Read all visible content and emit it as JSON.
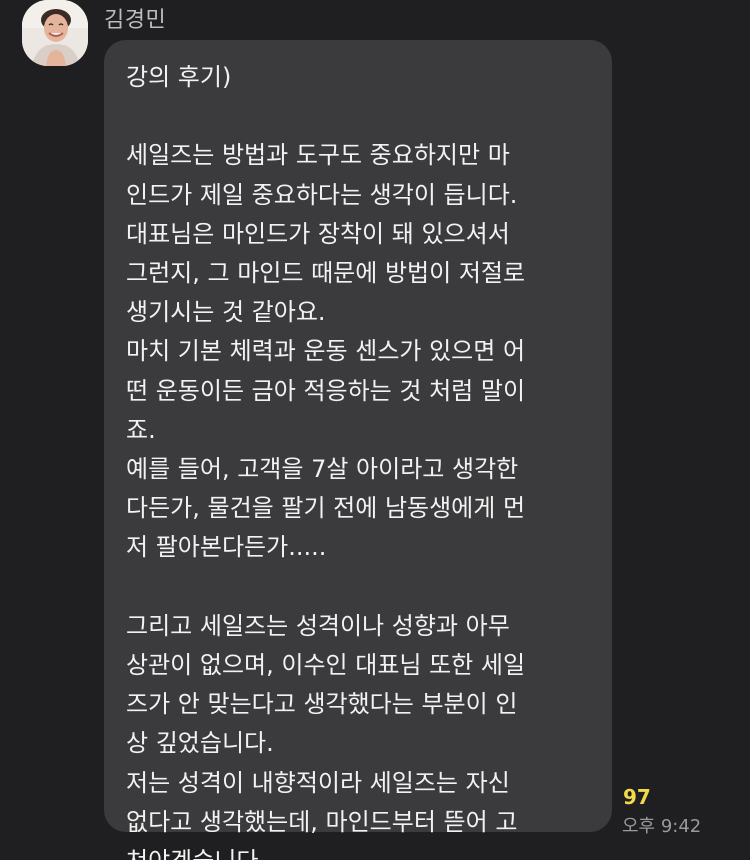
{
  "message": {
    "sender_name": "김경민",
    "text": "강의 후기)\n\n세일즈는 방법과 도구도 중요하지만 마\n인드가 제일 중요하다는 생각이 듭니다.\n대표님은 마인드가 장착이 돼 있으셔서\n그런지, 그 마인드 때문에 방법이 저절로\n생기시는 것 같아요.\n마치 기본 체력과 운동 센스가 있으면 어\n떤 운동이든 금아 적응하는 것 처럼 말이\n죠.\n예를 들어, 고객을 7살 아이라고 생각한\n다든가, 물건을 팔기 전에 남동생에게 먼\n저 팔아본다든가.....\n\n그리고 세일즈는 성격이나 성향과 아무\n상관이 없으며, 이수인 대표님 또한 세일\n즈가 안 맞는다고 생각했다는 부분이 인\n상 깊었습니다.\n저는 성격이 내향적이라 세일즈는 자신\n없다고 생각했는데, 마인드부터 뜯어 고\n쳐야겠습니다.",
    "unread_count": "97",
    "time": "오후 9:42"
  },
  "colors": {
    "background": "#1f1f21",
    "bubble": "#3b3b3d",
    "text": "#f2f2f2",
    "unread": "#f2d94a",
    "time": "#9a9a9c"
  },
  "icons": {
    "avatar": "profile-photo"
  }
}
